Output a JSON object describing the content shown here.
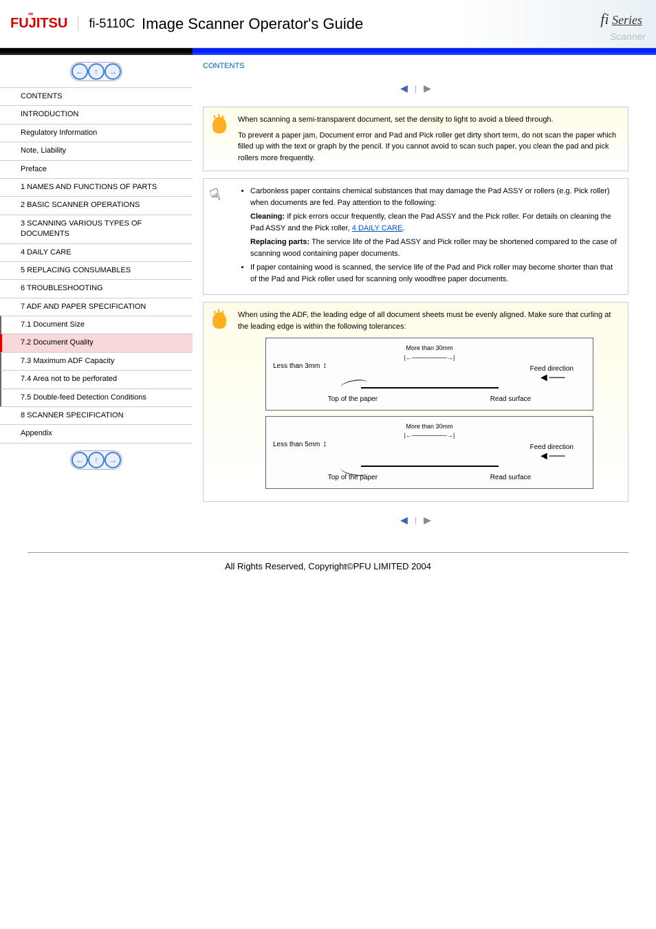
{
  "header": {
    "brand": "FUJITSU",
    "model": "fi-5110C",
    "title": "Image Scanner Operator's Guide",
    "series": "fi Series",
    "scanner_text": "Scanner"
  },
  "breadcrumb": "CONTENTS",
  "toc": {
    "items": [
      "CONTENTS",
      "INTRODUCTION",
      "Regulatory Information",
      "Note, Liability",
      "Preface",
      "1 NAMES AND FUNCTIONS OF PARTS",
      "2 BASIC SCANNER OPERATIONS",
      "3 SCANNING VARIOUS TYPES OF DOCUMENTS",
      "4 DAILY CARE",
      "5 REPLACING CONSUMABLES",
      "6 TROUBLESHOOTING",
      "7 ADF AND PAPER SPECIFICATION",
      "7.1 Document Size",
      "7.2 Document Quality",
      "7.3 Maximum ADF Capacity",
      "7.4 Area not to be perforated",
      "7.5 Double-feed Detection Conditions",
      "8 SCANNER SPECIFICATION",
      "Appendix"
    ],
    "active_index": 13
  },
  "hint1": {
    "text": "When scanning a semi-transparent document, set the density to light to avoid a bleed through.",
    "subtext": "To prevent a paper jam, Document error and Pad and Pick roller get dirty short term, do not scan the paper which filled up with the text or graph by the pencil. If you cannot avoid to scan such paper, you clean the pad and pick rollers more frequently."
  },
  "attention": {
    "items": [
      "Carbonless paper contains chemical substances that may damage the Pad ASSY or rollers (e.g. Pick roller) when documents are fed. Pay attention to the following:",
      {
        "label": "Cleaning:",
        "text": "If pick errors occur frequently, clean the Pad ASSY and the Pick roller. For details on cleaning the Pad ASSY and the Pick roller, ",
        "link_text": "4 DAILY CARE",
        "suffix": "."
      },
      {
        "label": "Replacing parts:",
        "text": "The service life of the Pad ASSY and Pick roller may be shortened compared to the case of scanning wood containing paper documents."
      },
      "If paper containing wood is scanned, the service life of the Pad and Pick roller may become shorter than that of the Pad and Pick roller used for scanning only woodfree paper documents."
    ]
  },
  "hint2": {
    "intro": "When using the ADF, the leading edge of all document sheets must be evenly aligned. Make sure that curling at the leading edge is within the following tolerances:",
    "diagram1": {
      "width_label": "More than 30mm",
      "height_label": "Less than 3mm",
      "feed_label": "Feed direction",
      "top_label": "Top of the paper",
      "surface_label": "Read surface"
    },
    "diagram2": {
      "width_label": "More than 30mm",
      "height_label": "Less than 5mm",
      "feed_label": "Feed direction",
      "top_label": "Top of the paper",
      "surface_label": "Read surface"
    }
  },
  "footer": "All Rights Reserved, Copyright©PFU LIMITED 2004"
}
